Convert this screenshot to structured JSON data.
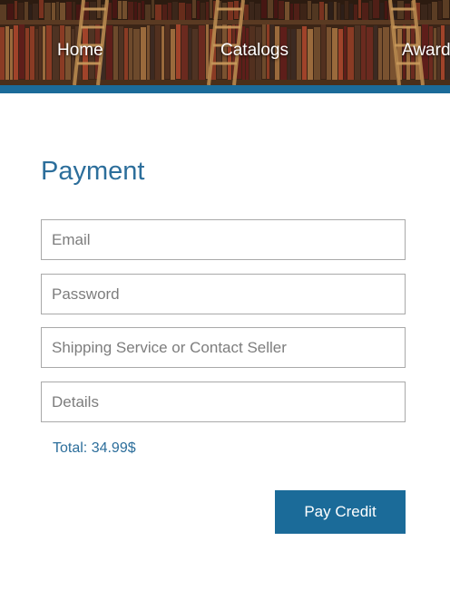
{
  "nav": {
    "items": [
      {
        "label": "Home"
      },
      {
        "label": "Catalogs"
      },
      {
        "label": "Awards"
      }
    ]
  },
  "form": {
    "title": "Payment",
    "email_placeholder": "Email",
    "password_placeholder": "Password",
    "shipping_placeholder": "Shipping Service or Contact Seller",
    "details_placeholder": "Details",
    "total": "Total: 34.99$",
    "submit_label": "Pay Credit"
  },
  "colors": {
    "accent": "#1b6b99",
    "title": "#2c6e9b"
  },
  "header": {
    "background": "bookshelf-library-image"
  }
}
